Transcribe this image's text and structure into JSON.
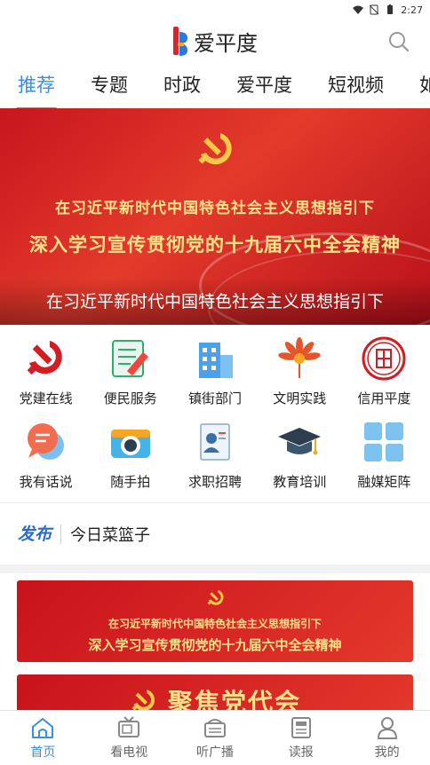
{
  "status_bar": {
    "time": "2:27"
  },
  "header": {
    "title": "爱平度"
  },
  "tabs": [
    {
      "label": "推荐",
      "active": true
    },
    {
      "label": "专题"
    },
    {
      "label": "时政"
    },
    {
      "label": "爱平度"
    },
    {
      "label": "短视频"
    },
    {
      "label": "如"
    }
  ],
  "banner": {
    "line1": "在习近平新时代中国特色社会主义思想指引下",
    "line2": "深入学习宣传贯彻党的十九届六中全会精神",
    "caption": "在习近平新时代中国特色社会主义思想指引下"
  },
  "services": [
    {
      "label": "党建在线",
      "icon": "party-emblem-icon"
    },
    {
      "label": "便民服务",
      "icon": "notepad-pencil-icon"
    },
    {
      "label": "镇街部门",
      "icon": "building-icon"
    },
    {
      "label": "文明实践",
      "icon": "sunflower-icon"
    },
    {
      "label": "信用平度",
      "icon": "credit-seal-icon"
    },
    {
      "label": "我有话说",
      "icon": "chat-bubble-icon"
    },
    {
      "label": "随手拍",
      "icon": "camera-icon"
    },
    {
      "label": "求职招聘",
      "icon": "resume-icon"
    },
    {
      "label": "教育培训",
      "icon": "graduation-cap-icon"
    },
    {
      "label": "融媒矩阵",
      "icon": "matrix-grid-icon"
    }
  ],
  "notice": {
    "brand": "发布",
    "text": "今日菜篮子"
  },
  "news": [
    {
      "line1": "在习近平新时代中国特色社会主义思想指引下",
      "line2": "深入学习宣传贯彻党的十九届六中全会精神"
    },
    {
      "title": "聚焦党代会"
    }
  ],
  "bottom_nav": [
    {
      "label": "首页",
      "icon": "home-icon",
      "active": true
    },
    {
      "label": "看电视",
      "icon": "tv-icon"
    },
    {
      "label": "听广播",
      "icon": "radio-icon"
    },
    {
      "label": "读报",
      "icon": "newspaper-icon"
    },
    {
      "label": "我的",
      "icon": "user-icon"
    }
  ],
  "colors": {
    "accent": "#3a8ee6",
    "party_red": "#d21d22",
    "gold": "#fbe38c"
  }
}
